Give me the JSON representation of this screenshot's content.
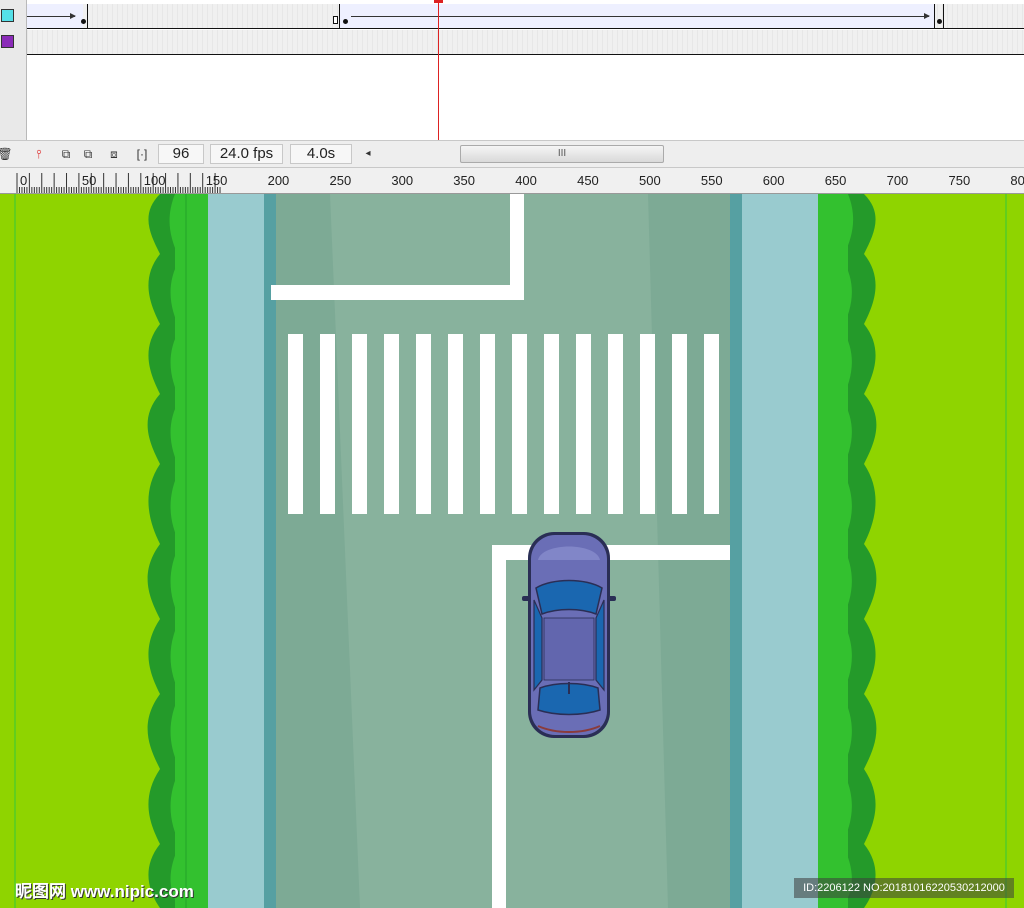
{
  "timeline": {
    "layers": [
      {
        "name": "cyan-layer",
        "color": "#55e0e8"
      },
      {
        "name": "purple-layer",
        "color": "#8a2bb8"
      }
    ],
    "toolbar": {
      "current_frame": "96",
      "frame_rate": "24.0 fps",
      "elapsed_time": "4.0s",
      "scroll_arrow_left": "◂",
      "scroll_thumb_grip": "III"
    }
  },
  "ruler": {
    "labels": [
      "0",
      "50",
      "100",
      "150",
      "200",
      "250",
      "300",
      "350",
      "400",
      "450",
      "500",
      "550",
      "600",
      "650",
      "700",
      "750",
      "80"
    ]
  },
  "colors": {
    "grass": "#8fd400",
    "hedge_light": "#33c12f",
    "hedge_dark": "#249a2a",
    "sidewalk": "#99cbcf",
    "curb": "#56a0a2",
    "road": "#88b29d",
    "road_shade": "#7aa893",
    "marking": "#ffffff",
    "car_body": "#6a6eb6",
    "car_glass": "#1a67b0"
  },
  "watermark": {
    "left": "昵图网 www.nipic.com",
    "right": "ID:2206122 NO:20181016220530212000"
  }
}
